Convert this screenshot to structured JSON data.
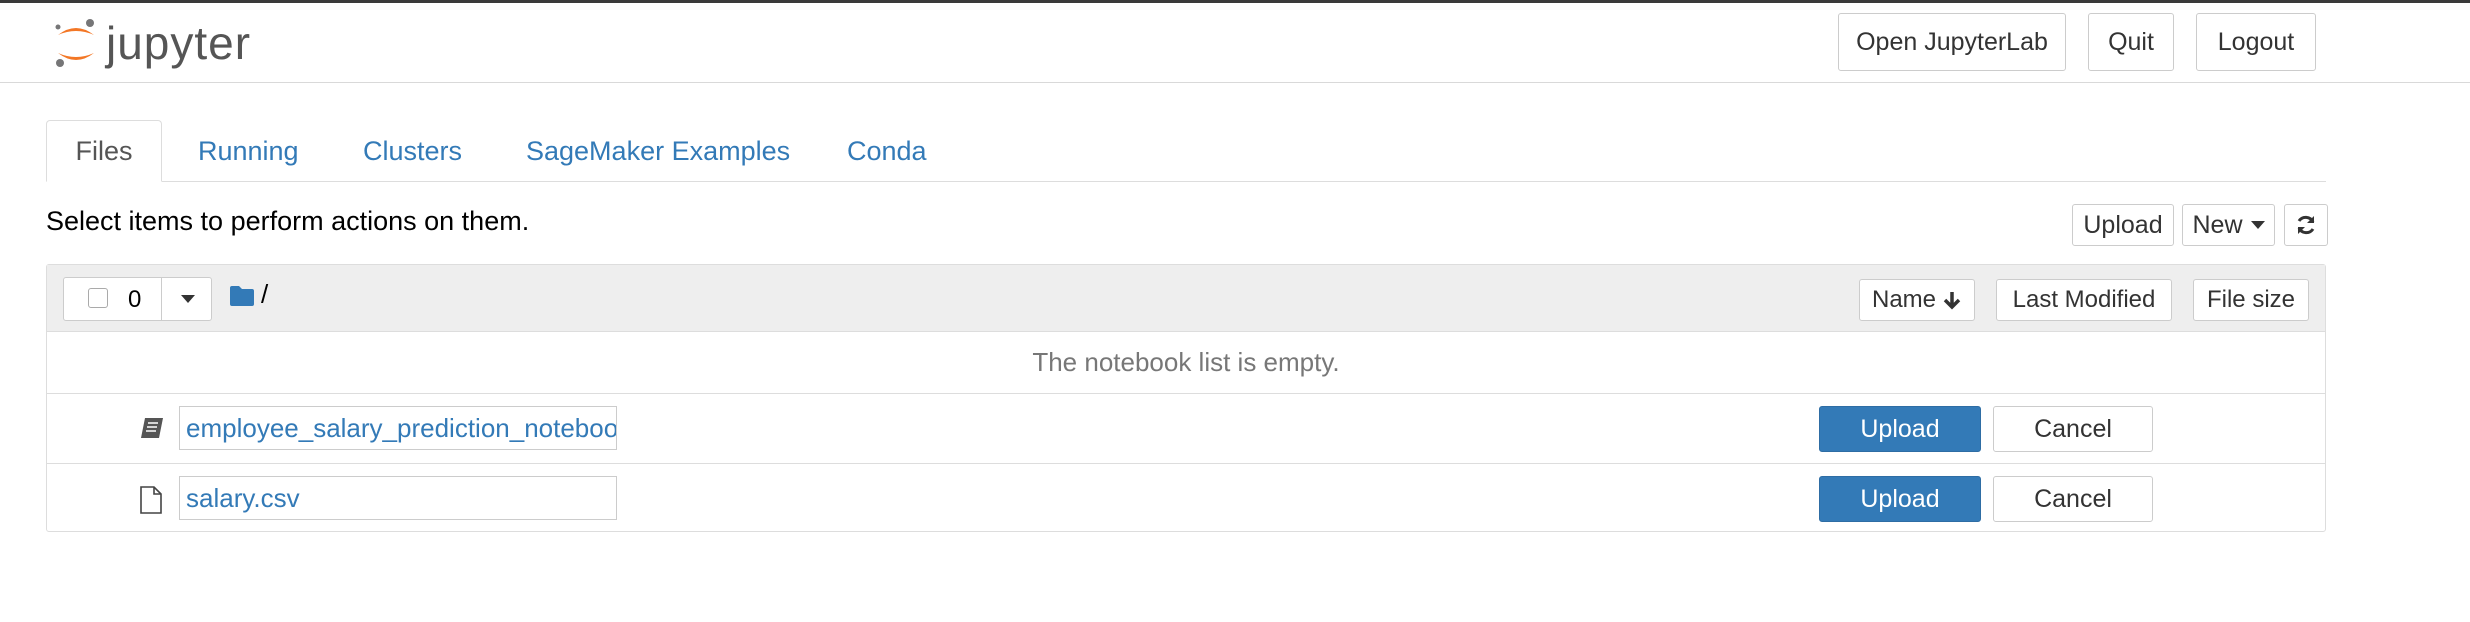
{
  "header": {
    "logo_text": "jupyter",
    "buttons": {
      "open_jupyterlab": "Open JupyterLab",
      "quit": "Quit",
      "logout": "Logout"
    }
  },
  "tabs": [
    {
      "label": "Files",
      "active": true
    },
    {
      "label": "Running",
      "active": false
    },
    {
      "label": "Clusters",
      "active": false
    },
    {
      "label": "SageMaker Examples",
      "active": false
    },
    {
      "label": "Conda",
      "active": false
    }
  ],
  "instruction": "Select items to perform actions on them.",
  "toolbar": {
    "upload": "Upload",
    "new": "New",
    "refresh_icon": "refresh-icon"
  },
  "list": {
    "selected_count": "0",
    "path": "/",
    "sort": {
      "name": "Name",
      "last_modified": "Last Modified",
      "file_size": "File size"
    },
    "empty_message": "The notebook list is empty.",
    "pending_uploads": [
      {
        "name": "employee_salary_prediction_notebook.ipynb",
        "icon": "notebook-icon",
        "upload": "Upload",
        "cancel": "Cancel"
      },
      {
        "name": "salary.csv",
        "icon": "file-icon",
        "upload": "Upload",
        "cancel": "Cancel"
      }
    ]
  },
  "colors": {
    "link": "#337ab7",
    "primary_button": "#337ab7",
    "logo_orange": "#f37726",
    "header_bg": "#eeeeee"
  }
}
